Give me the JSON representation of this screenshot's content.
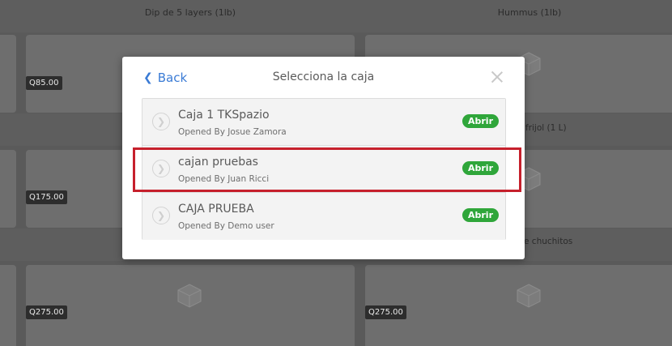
{
  "background": {
    "top_labels": [
      "Dip de 5 layers (1lb)",
      "Hummus (1lb)"
    ],
    "mid_label_right_partial": "frijol (1 L)",
    "lower_label_right_partial": "e chuchitos",
    "prices": {
      "row1_left": "Q85.00",
      "row2_left": "Q175.00",
      "row3_left": "Q275.00",
      "row3_right": "Q275.00"
    },
    "icons": [
      "box-icon"
    ]
  },
  "modal": {
    "back_label": "Back",
    "title": "Selecciona la caja",
    "close_icon": "close-icon",
    "cajas": [
      {
        "name": "Caja 1 TKSpazio",
        "opened_by": "Opened By Josue Zamora",
        "action": "Abrir"
      },
      {
        "name": "cajan pruebas",
        "opened_by": "Opened By Juan Ricci",
        "action": "Abrir"
      },
      {
        "name": "CAJA PRUEBA",
        "opened_by": "Opened By Demo user",
        "action": "Abrir"
      }
    ]
  },
  "colors": {
    "accent_blue": "#3a7bd5",
    "abrir_green": "#2fa63a",
    "highlight_red": "#c6202c"
  }
}
